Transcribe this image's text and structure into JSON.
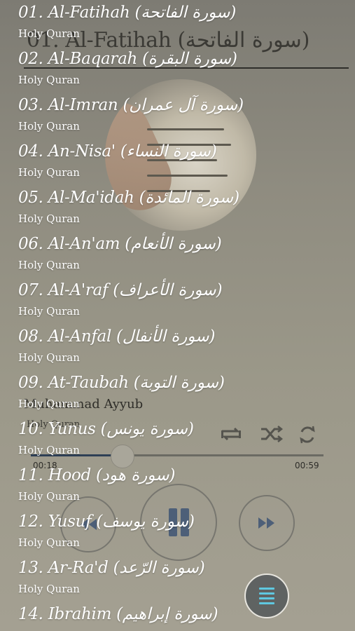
{
  "now_playing": {
    "title": "01. Al-Fatihah (سورة الفاتحة)",
    "reciter": "Muhammad Ayyub",
    "album": "Holy Quran",
    "elapsed": "00:18",
    "duration": "00:59",
    "progress": 0.31
  },
  "controls": {
    "repeat_icon": "repeat-icon",
    "shuffle_icon": "shuffle-icon",
    "refresh_icon": "refresh-icon",
    "prev_icon": "previous-icon",
    "pause_icon": "pause-icon",
    "next_icon": "next-icon",
    "menu_icon": "playlist-menu-icon"
  },
  "playlist": {
    "items": [
      {
        "title": "01. Al-Fatihah (سورة الفاتحة)",
        "subtitle": "Holy Quran"
      },
      {
        "title": "02. Al-Baqarah (سورة البقرة)",
        "subtitle": "Holy Quran"
      },
      {
        "title": "03. Al-Imran (سورة آل عمران)",
        "subtitle": "Holy Quran"
      },
      {
        "title": "04. An-Nisa' (سورة النساء)",
        "subtitle": "Holy Quran"
      },
      {
        "title": "05. Al-Ma'idah (سورة المائدة)",
        "subtitle": "Holy Quran"
      },
      {
        "title": "06. Al-An'am (سورة الأنعام)",
        "subtitle": "Holy Quran"
      },
      {
        "title": "07. Al-A'raf (سورة الأعراف)",
        "subtitle": "Holy Quran"
      },
      {
        "title": "08. Al-Anfal (سورة الأنفال)",
        "subtitle": "Holy Quran"
      },
      {
        "title": "09. At-Taubah (سورة التوبة)",
        "subtitle": "Holy Quran"
      },
      {
        "title": "10. Yunus (سورة يونس)",
        "subtitle": "Holy Quran"
      },
      {
        "title": "11. Hood (سورة هود)",
        "subtitle": "Holy Quran"
      },
      {
        "title": "12. Yusuf (سورة يوسف)",
        "subtitle": "Holy Quran"
      },
      {
        "title": "13. Ar-Ra'd (سورة الرّعد)",
        "subtitle": "Holy Quran"
      },
      {
        "title": "14. Ibrahim (سورة إبراهيم)",
        "subtitle": ""
      }
    ]
  },
  "colors": {
    "accent": "#5fc8e0",
    "seek_fill": "#2e3f55",
    "list_text": "#ffffff"
  }
}
